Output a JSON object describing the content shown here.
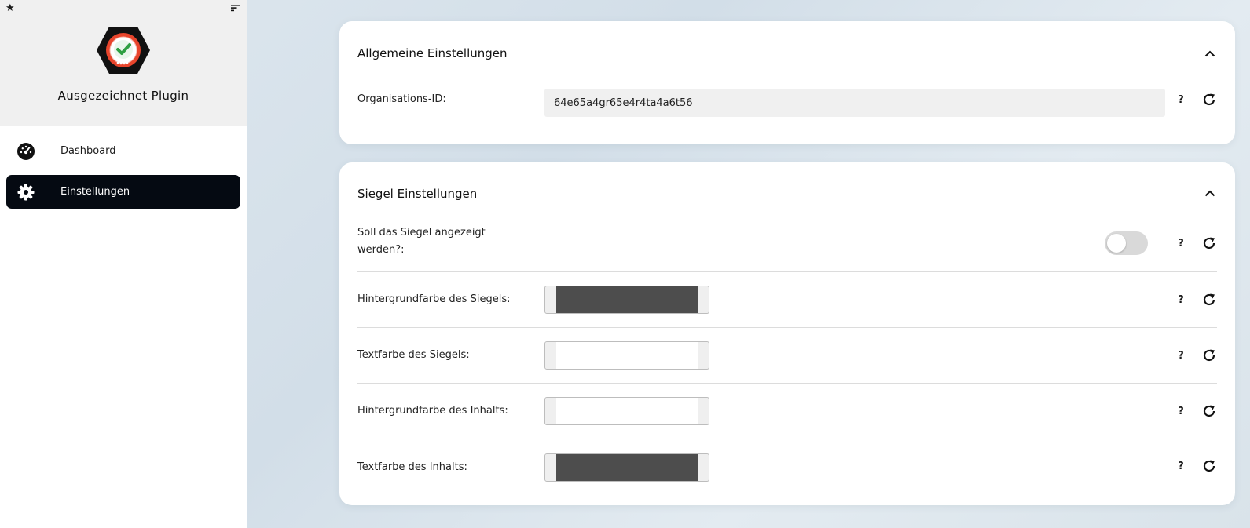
{
  "sidebar": {
    "title": "Ausgezeichnet Plugin",
    "top_left_icon": "star-icon",
    "top_right_icon": "sort-icon",
    "items": [
      {
        "label": "Dashboard",
        "icon": "dashboard-gauge-icon",
        "active": false
      },
      {
        "label": "Einstellungen",
        "icon": "gear-icon",
        "active": true
      }
    ]
  },
  "general": {
    "title": "Allgemeine Einstellungen",
    "org_id_label": "Organisations-ID:",
    "org_id_value": "64e65a4gr65e4r4ta4a6t56",
    "help": "?"
  },
  "seal": {
    "title": "Siegel Einstellungen",
    "show_label": "Soll das Siegel angezeigt werden?:",
    "show_enabled": false,
    "bg_label": "Hintergrundfarbe des Siegels:",
    "bg_color": "#4d4d4d",
    "text_label": "Textfarbe des Siegels:",
    "text_color": "#ffffff",
    "content_bg_label": "Hintergrundfarbe des Inhalts:",
    "content_bg_color": "#ffffff",
    "content_text_label": "Textfarbe des Inhalts:",
    "content_text_color": "#4d4d4d",
    "help": "?"
  },
  "colors": {
    "active_nav_bg": "#050a12",
    "card_bg": "#ffffff",
    "logo_red": "#e8452c",
    "logo_green": "#2ea043"
  }
}
